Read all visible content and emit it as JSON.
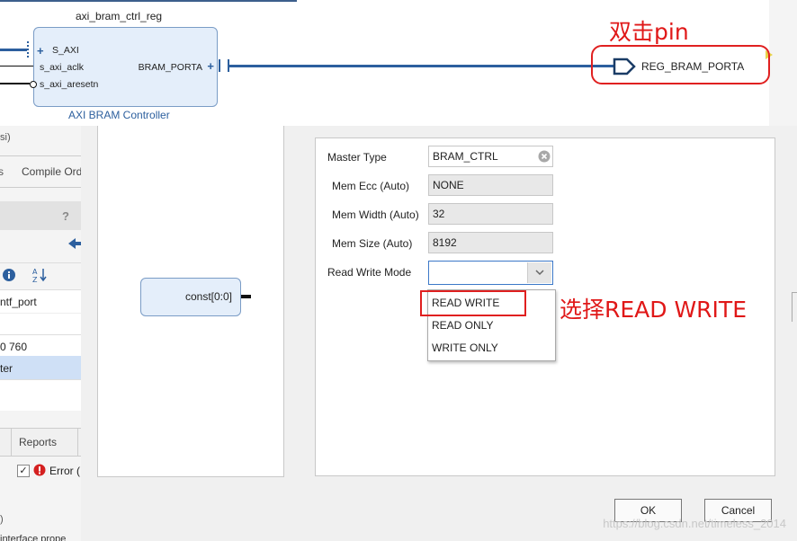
{
  "diagram": {
    "cell_name": "axi_bram_ctrl_reg",
    "block_title": "AXI BRAM Controller",
    "ports_left": [
      "S_AXI",
      "s_axi_aclk",
      "s_axi_aresetn"
    ],
    "port_right": "BRAM_PORTA",
    "external_pin": "REG_BRAM_PORTA"
  },
  "left_panel": {
    "item_si": "si)",
    "compile_tab": "Compile Ord",
    "help": "?",
    "intf_port": "ntf_port",
    "item_760": "0 760",
    "item_ter": "ter",
    "reports_tab": "Reports",
    "error_label": "Error (",
    "item_paren": ")",
    "interface_prop": "interface prope"
  },
  "dialog": {
    "const_block_label": "const[0:0]",
    "fields": {
      "master_type": {
        "label": "Master Type",
        "value": "BRAM_CTRL"
      },
      "mem_ecc": {
        "label": "Mem Ecc (Auto)",
        "value": "NONE"
      },
      "mem_width": {
        "label": "Mem Width (Auto)",
        "value": "32"
      },
      "mem_size": {
        "label": "Mem Size (Auto)",
        "value": "8192"
      },
      "read_write_mode": {
        "label": "Read Write Mode",
        "value": ""
      }
    },
    "dropdown_options": [
      "READ WRITE",
      "READ ONLY",
      "WRITE ONLY"
    ],
    "ok_label": "OK",
    "cancel_label": "Cancel"
  },
  "annotations": {
    "double_click_pin": "双击pin",
    "select_read_write": "选择READ WRITE"
  },
  "watermark": "https://blog.csdn.net/timeless_2014",
  "colors": {
    "annotation_red": "#e01818",
    "block_fill": "#e4eefa",
    "net_blue": "#2c5f9e"
  }
}
